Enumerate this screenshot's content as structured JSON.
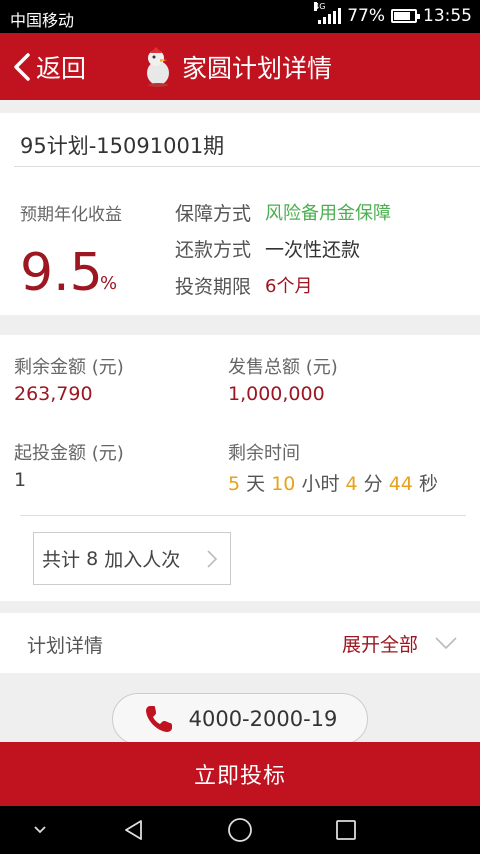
{
  "statusbar": {
    "carrier": "中国移动",
    "network": "4G",
    "battery": "77%",
    "time": "13:55"
  },
  "navbar": {
    "back_label": "返回",
    "title": "家圆计划详情"
  },
  "plan": {
    "name": "95计划-15091001期",
    "rate_label": "预期年化收益",
    "rate": "9.5",
    "rate_unit": "%",
    "info": [
      {
        "key": "保障方式",
        "value": "风险备用金保障"
      },
      {
        "key": "还款方式",
        "value": "一次性还款"
      },
      {
        "key": "投资期限",
        "value": "6个月"
      }
    ]
  },
  "amounts": {
    "remaining_label": "剩余金额 (元)",
    "remaining": "263,790",
    "total_label": "发售总额 (元)",
    "total": "1,000,000",
    "min_label": "起投金额 (元)",
    "min": "1",
    "time_label": "剩余时间",
    "time": {
      "days": "5",
      "days_unit": "天",
      "hours": "10",
      "hours_unit": "小时",
      "minutes": "4",
      "minutes_unit": "分",
      "seconds": "44",
      "seconds_unit": "秒"
    }
  },
  "join": {
    "prefix": "共计",
    "count": "8",
    "suffix": "加入人次"
  },
  "detail": {
    "label": "计划详情",
    "expand_label": "展开全部"
  },
  "hotline": "4000-2000-19",
  "submit_label": "立即投标",
  "colors": {
    "brand_red": "#c1121f",
    "value_red": "#9c1722",
    "green": "#4caf50",
    "orange": "#e6a21a"
  }
}
